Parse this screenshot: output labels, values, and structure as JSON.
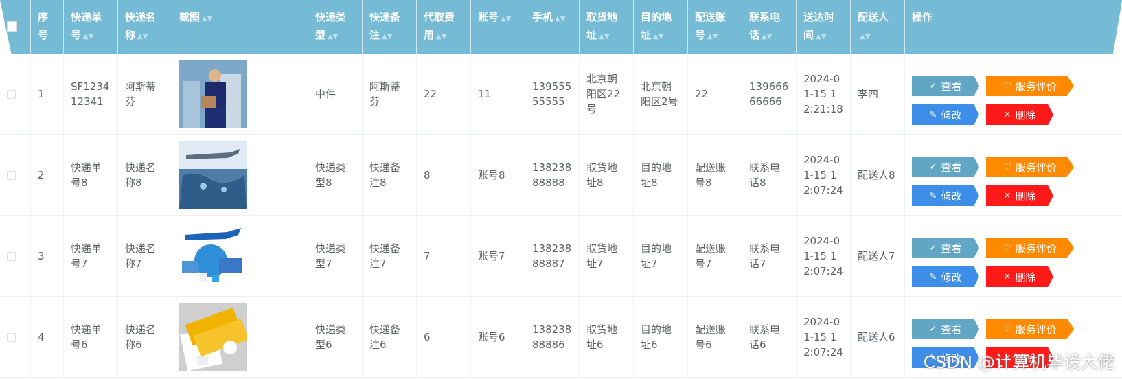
{
  "columns": [
    {
      "label": "序号",
      "sort": false
    },
    {
      "label": "快递单号",
      "sort": true
    },
    {
      "label": "快递名称",
      "sort": true
    },
    {
      "label": "截图",
      "sort": true
    },
    {
      "label": "快递类型",
      "sort": true
    },
    {
      "label": "快递备注",
      "sort": true
    },
    {
      "label": "代取费用",
      "sort": true
    },
    {
      "label": "账号",
      "sort": true
    },
    {
      "label": "手机",
      "sort": true
    },
    {
      "label": "取货地址",
      "sort": true
    },
    {
      "label": "目的地址",
      "sort": true
    },
    {
      "label": "配送账号",
      "sort": true
    },
    {
      "label": "联系电话",
      "sort": true
    },
    {
      "label": "送达时间",
      "sort": true
    },
    {
      "label": "配送人",
      "sort": true
    },
    {
      "label": "操作",
      "sort": false
    }
  ],
  "sort_icon": "▲▼",
  "rows": [
    {
      "index": "1",
      "tracking": "SF123412341",
      "name": "阿斯蒂芬",
      "type": "中件",
      "note": "阿斯蒂芬",
      "fee": "22",
      "account": "11",
      "phone": "13955555555",
      "pickup": "北京朝阳区22号",
      "dest": "北京朝阳区2号",
      "courier_account": "22",
      "contact": "13966666666",
      "time": "2024-01-15 12:21:18",
      "courier": "李四"
    },
    {
      "index": "2",
      "tracking": "快递单号8",
      "name": "快递名称8",
      "type": "快递类型8",
      "note": "快递备注8",
      "fee": "8",
      "account": "账号8",
      "phone": "13823888888",
      "pickup": "取货地址8",
      "dest": "目的地址8",
      "courier_account": "配送账号8",
      "contact": "联系电话8",
      "time": "2024-01-15 12:07:24",
      "courier": "配送人8"
    },
    {
      "index": "3",
      "tracking": "快递单号7",
      "name": "快递名称7",
      "type": "快递类型7",
      "note": "快递备注7",
      "fee": "7",
      "account": "账号7",
      "phone": "13823888887",
      "pickup": "取货地址7",
      "dest": "目的地址7",
      "courier_account": "配送账号7",
      "contact": "联系电话7",
      "time": "2024-01-15 12:07:24",
      "courier": "配送人7"
    },
    {
      "index": "4",
      "tracking": "快递单号6",
      "name": "快递名称6",
      "type": "快递类型6",
      "note": "快递备注6",
      "fee": "6",
      "account": "账号6",
      "phone": "13823888886",
      "pickup": "取货地址6",
      "dest": "目的地址6",
      "courier_account": "配送账号6",
      "contact": "联系电话6",
      "time": "2024-01-15 12:07:24",
      "courier": "配送人6"
    }
  ],
  "actions": {
    "view": "查看",
    "rate": "服务评价",
    "edit": "修改",
    "delete": "删除"
  },
  "icons": {
    "view": "check-icon",
    "rate": "heart-icon",
    "edit": "pen-icon",
    "delete": "close-icon"
  },
  "watermark": "CSDN @计算机毕设大佬",
  "colors": {
    "header": "#76bbd6",
    "view": "#62a6c5",
    "rate": "#ff8a00",
    "edit": "#3d8ee8",
    "delete": "#ff1a1a"
  }
}
